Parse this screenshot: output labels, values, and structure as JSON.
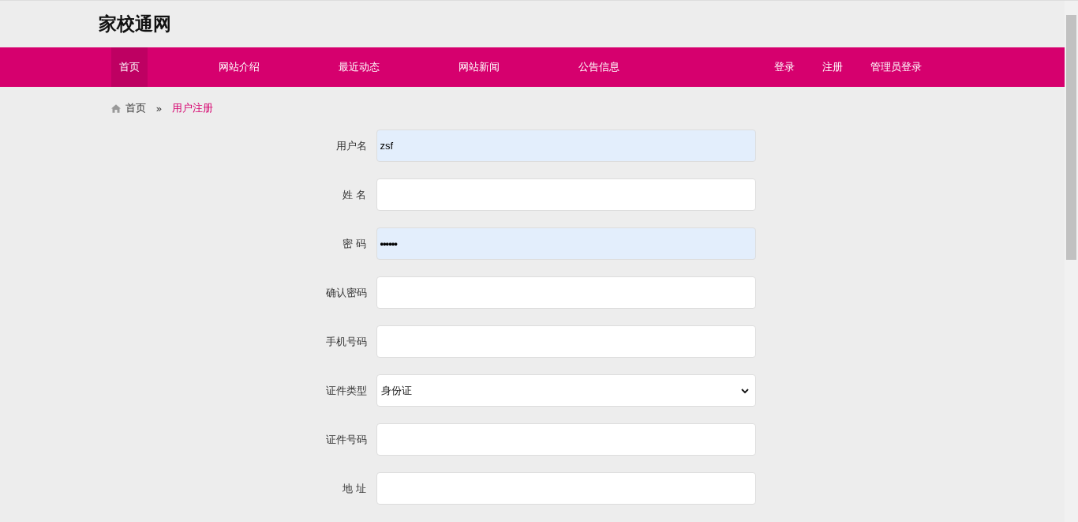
{
  "site_title": "家校通网",
  "nav": {
    "left": [
      {
        "label": "首页",
        "selected": true
      },
      {
        "label": "网站介绍",
        "selected": false
      },
      {
        "label": "最近动态",
        "selected": false
      },
      {
        "label": "网站新闻",
        "selected": false
      },
      {
        "label": "公告信息",
        "selected": false
      }
    ],
    "right": [
      {
        "label": "登录",
        "selected": false
      },
      {
        "label": "注册",
        "selected": false
      },
      {
        "label": "管理员登录",
        "selected": false
      }
    ]
  },
  "breadcrumb": {
    "home": "首页",
    "separator": "»",
    "current": "用户注册"
  },
  "form": [
    {
      "label": "用户名",
      "kind": "text",
      "value": "zsf",
      "autofilled": true
    },
    {
      "label": "姓 名",
      "kind": "text",
      "autofilled": false
    },
    {
      "label": "密 码",
      "kind": "password",
      "value": "••••••",
      "autofilled": true
    },
    {
      "label": "确认密码",
      "kind": "text",
      "autofilled": false
    },
    {
      "label": "手机号码",
      "kind": "text",
      "autofilled": false
    },
    {
      "label": "证件类型",
      "kind": "select",
      "value": "身份证",
      "autofilled": false
    },
    {
      "label": "证件号码",
      "kind": "text",
      "autofilled": false
    },
    {
      "label": "地 址",
      "kind": "text",
      "autofilled": false
    }
  ]
}
